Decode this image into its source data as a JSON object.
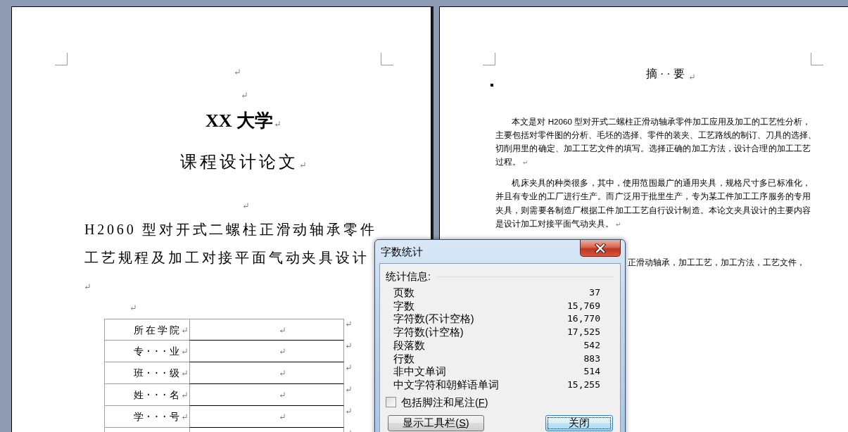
{
  "formatting_marks": true,
  "cover_page": {
    "university": "XX 大学",
    "document_type": "课程设计论文",
    "thesis_title": [
      "H2060 型对开式二螺柱正滑动轴承零件",
      "工艺规程及加工对接平面气动夹具设计"
    ],
    "info_table": [
      {
        "label": "所在学院"
      },
      {
        "label": "专···业"
      },
      {
        "label": "班···级"
      },
      {
        "label": "姓···名"
      },
      {
        "label": "学···号"
      }
    ]
  },
  "abstract_page": {
    "heading": "摘··要",
    "paragraphs": [
      {
        "lines": [
          "本文是对 H2060 型对开式二螺柱正滑动轴承零件加工应用及加工的工艺性分析，",
          "主要包括对零件图的分析、毛坯的选择、零件的装夹、工艺路线的制订、刀具的选择、",
          "切削用里的确定、加工工艺文件的填写。选择正确的加工方法，设计合理的加工工艺",
          "过程。"
        ],
        "end_mark": "↵"
      },
      {
        "lines": [
          "机床夹具的种类很多，其中，使用范围最广的通用夹具，规格尺寸多已标准化，",
          "并且有专业的工厂进行生产。而广泛用于批里生产，专为某工件加工工序服务的专用",
          "夹具，则需要各制造厂根据工件加工工艺自行设计制造。本论文夹具设计的主要内容",
          "是设计加工对接平面气动夹具。"
        ],
        "end_mark": "↵"
      }
    ],
    "keywords_visible": "正滑动轴承，加工工艺，加工方法，工艺文件，"
  },
  "word_count_dialog": {
    "title": "字数统计",
    "section": "统计信息:",
    "stats": [
      {
        "label": "页数",
        "value": "37"
      },
      {
        "label": "字数",
        "value": "15,769"
      },
      {
        "label": "字符数(不计空格)",
        "value": "16,770"
      },
      {
        "label": "字符数(计空格)",
        "value": "17,525"
      },
      {
        "label": "段落数",
        "value": "542"
      },
      {
        "label": "行数",
        "value": "883"
      },
      {
        "label": "非中文单词",
        "value": "514"
      },
      {
        "label": "中文字符和朝鲜语单词",
        "value": "15,255"
      }
    ],
    "include_notes": {
      "label": "包括脚注和尾注(",
      "access_key": "F",
      "label_end": ")",
      "checked": false
    },
    "buttons": [
      {
        "label": "显示工具栏(",
        "access_key": "S",
        "label_end": ")",
        "kind": "normal"
      },
      {
        "label": "关闭",
        "kind": "default"
      }
    ]
  }
}
